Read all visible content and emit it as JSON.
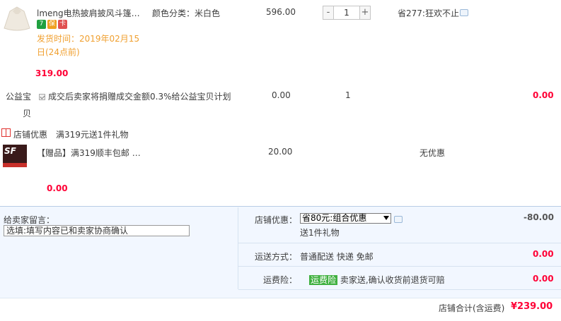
{
  "product": {
    "title": "lmeng电热披肩披风斗篷…",
    "sku": "颜色分类：米白色",
    "price": "596.00",
    "qty": "1",
    "promo": "省277:狂欢不止",
    "ship_line1": "发货时间：2019年02月15",
    "ship_line2": "日(24点前)",
    "subtotal": "319.00",
    "badges": [
      "7",
      "保",
      "卡"
    ]
  },
  "charity": {
    "label1": "公益宝",
    "label2": "贝",
    "text": "成交后卖家将捐赠成交金额0.3%给公益宝贝计划",
    "price": "0.00",
    "qty": "1",
    "total": "0.00"
  },
  "shop_promo": {
    "title": "店铺优惠",
    "rule": "满319元送1件礼物"
  },
  "gift": {
    "logo": "SF",
    "title": "【赠品】满319顺丰包邮 …",
    "price": "20.00",
    "discount": "无优惠",
    "total": "0.00"
  },
  "footer": {
    "message_label": "给卖家留言：",
    "message_placeholder": "选填:填写内容已和卖家协商确认",
    "shop_discount_label": "店铺优惠：",
    "shop_discount_selected": "省80元:组合优惠",
    "shop_discount_sub": "送1件礼物",
    "shop_discount_amount": "-80.00",
    "shipping_label": "运送方式：",
    "shipping_value": "普通配送 快递 免邮",
    "shipping_amount": "0.00",
    "insurance_label": "运费险：",
    "insurance_tag": "运费险",
    "insurance_text": "卖家送,确认收货前退货可赔",
    "insurance_amount": "0.00",
    "total_label": "店铺合计(含运费)",
    "total_value": "¥239.00"
  },
  "colors": {
    "accent_red": "#ff0036",
    "ship_orange": "#f0a030",
    "footer_bg": "#f2f7ff"
  }
}
